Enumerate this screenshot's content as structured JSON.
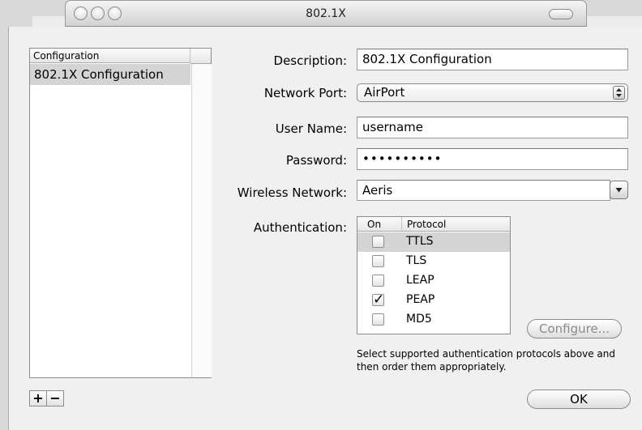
{
  "window": {
    "title": "802.1X"
  },
  "config_list": {
    "header": "Configuration",
    "items": [
      "802.1X Configuration"
    ],
    "add_label": "+",
    "remove_label": "−"
  },
  "form": {
    "description_label": "Description:",
    "description_value": "802.1X Configuration",
    "network_port_label": "Network Port:",
    "network_port_value": "AirPort",
    "username_label": "User Name:",
    "username_value": "username",
    "password_label": "Password:",
    "password_value": "••••••••••",
    "wireless_label": "Wireless Network:",
    "wireless_value": "Aeris",
    "auth_label": "Authentication:"
  },
  "protocols": {
    "col_on": "On",
    "col_protocol": "Protocol",
    "rows": [
      {
        "name": "TTLS",
        "on": false,
        "selected": true
      },
      {
        "name": "TLS",
        "on": false,
        "selected": false
      },
      {
        "name": "LEAP",
        "on": false,
        "selected": false
      },
      {
        "name": "PEAP",
        "on": true,
        "selected": false
      },
      {
        "name": "MD5",
        "on": false,
        "selected": false
      }
    ],
    "check_mark": "✓"
  },
  "buttons": {
    "configure": "Configure...",
    "ok": "OK"
  },
  "hint": "Select supported authentication protocols above and then order them appropriately."
}
